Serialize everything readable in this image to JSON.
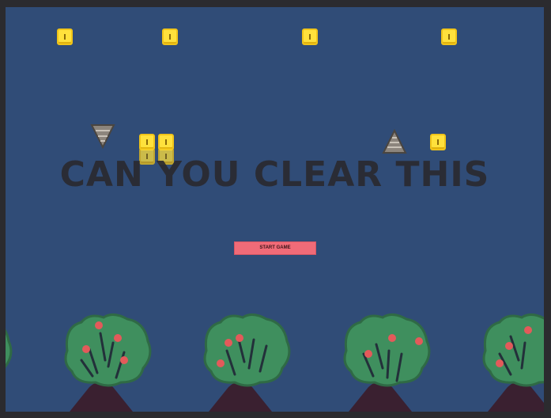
{
  "game": {
    "title": "CAN YOU CLEAR THIS",
    "start_button_label": "START GAME"
  },
  "colors": {
    "sky": "#304c77",
    "border": "#2b2b2f",
    "coin": "#ffe13c",
    "title": "#2a2a30",
    "start_button": "#f06b78",
    "tree_foliage": "#3f8f5e",
    "tree_outline": "#2f6a45",
    "tree_trunk": "#3a2030",
    "apple": "#e35a5a",
    "spike": "#8c857d"
  },
  "sprites": {
    "coins": [
      "coin",
      "coin",
      "coin",
      "coin",
      "coin",
      "coin",
      "coin",
      "coin",
      "coin"
    ],
    "hazards": [
      "spike-down-icon",
      "spike-up-icon"
    ],
    "trees": [
      "apple-tree",
      "apple-tree",
      "apple-tree",
      "apple-tree",
      "apple-tree"
    ]
  }
}
